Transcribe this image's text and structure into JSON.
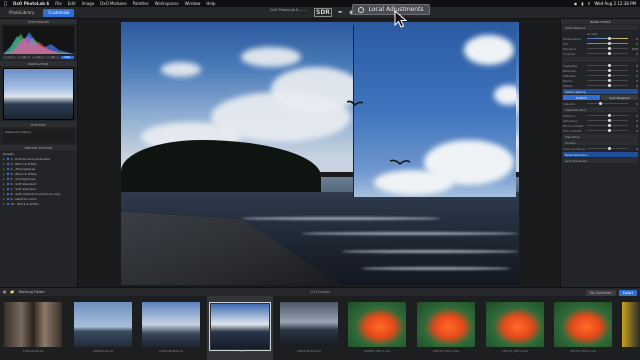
{
  "menubar": {
    "apple": "",
    "app_name": "DxO PhotoLab 6",
    "items": [
      "File",
      "Edit",
      "Image",
      "DxO Modules",
      "Palettes",
      "Workspaces",
      "Window",
      "Help"
    ],
    "clock": "Wed Aug 2 12:38 PM"
  },
  "toolbar": {
    "tabs": [
      "PhotoLibrary",
      "Customize"
    ],
    "doc_title": "DxO PhotoLab 6 — ...",
    "sdr": "SDR",
    "compare": "Compare",
    "local_adjustments": "Local Adjustments"
  },
  "left_panel": {
    "histogram_title": "HISTOGRAM",
    "hist_channels": [
      "L",
      "R",
      "G",
      "B",
      "RGB"
    ],
    "navigator_title": "NAVIGATOR",
    "history_title": "HISTORY",
    "history_item": "Advanced history",
    "preset_title": "PRESET EDITOR",
    "presets_label": "Presets",
    "presets": [
      "1 - Portrait and Landscape",
      "2 - Black & White",
      "3 - Atmospheres",
      "4 - Black & White",
      "5 - Smartphones",
      "6 - Soft Standard",
      "7 - Soft Standard",
      "8 - Soft (Optical Corrections only)",
      "9 - Neutral colors",
      "10 - Black & White"
    ]
  },
  "right_panel": {
    "section_title": "BASIC TOOLS",
    "white_balance": "White Balance",
    "wb_setting": "As Shot",
    "rows": [
      {
        "label": "Temperature",
        "value": "0"
      },
      {
        "label": "Tint",
        "value": "0"
      },
      {
        "label": "Exposure",
        "value": "0.00"
      },
      {
        "label": "Contrast",
        "value": "0"
      },
      {
        "label": "Highlights",
        "value": "0"
      },
      {
        "label": "Midtones",
        "value": "0"
      },
      {
        "label": "Shadows",
        "value": "0"
      },
      {
        "label": "Blacks",
        "value": "0"
      },
      {
        "label": "Whites",
        "value": "0"
      }
    ],
    "smart_lighting": "Smart Lighting",
    "seg_uniform": "Uniform",
    "seg_spot": "Spot Weighted",
    "clearview": "ClearView Plus",
    "vignetting": "Vignetting",
    "horizon": "Horizon",
    "rows2": [
      {
        "label": "Intensity",
        "value": "0"
      },
      {
        "label": "Vibrancy",
        "value": "0"
      },
      {
        "label": "Saturation",
        "value": "0"
      },
      {
        "label": "Micro-contrast",
        "value": "0"
      },
      {
        "label": "Fine contrast",
        "value": "0"
      },
      {
        "label": "Color rendering",
        "value": "0"
      }
    ],
    "noise": "Noise Reduction",
    "lens": "Lens Sharpness"
  },
  "filmbar": {
    "left_label": "Working Folder",
    "count": "1/13 images",
    "sort": "Sort",
    "project": "My Collection",
    "export": "Export"
  },
  "thumbnails": [
    {
      "label": "230613D-06.raf"
    },
    {
      "label": "230607D-04.raf"
    },
    {
      "label": "230617M-0056.raf"
    },
    {
      "label": "... .arw"
    },
    {
      "label": "230611M-0059.raf"
    },
    {
      "label": "230630_0451-1.arw"
    },
    {
      "label": "230704_0451-2.arw"
    },
    {
      "label": "230704_0451-3.arw"
    },
    {
      "label": "230704_0451-4.arw"
    }
  ]
}
